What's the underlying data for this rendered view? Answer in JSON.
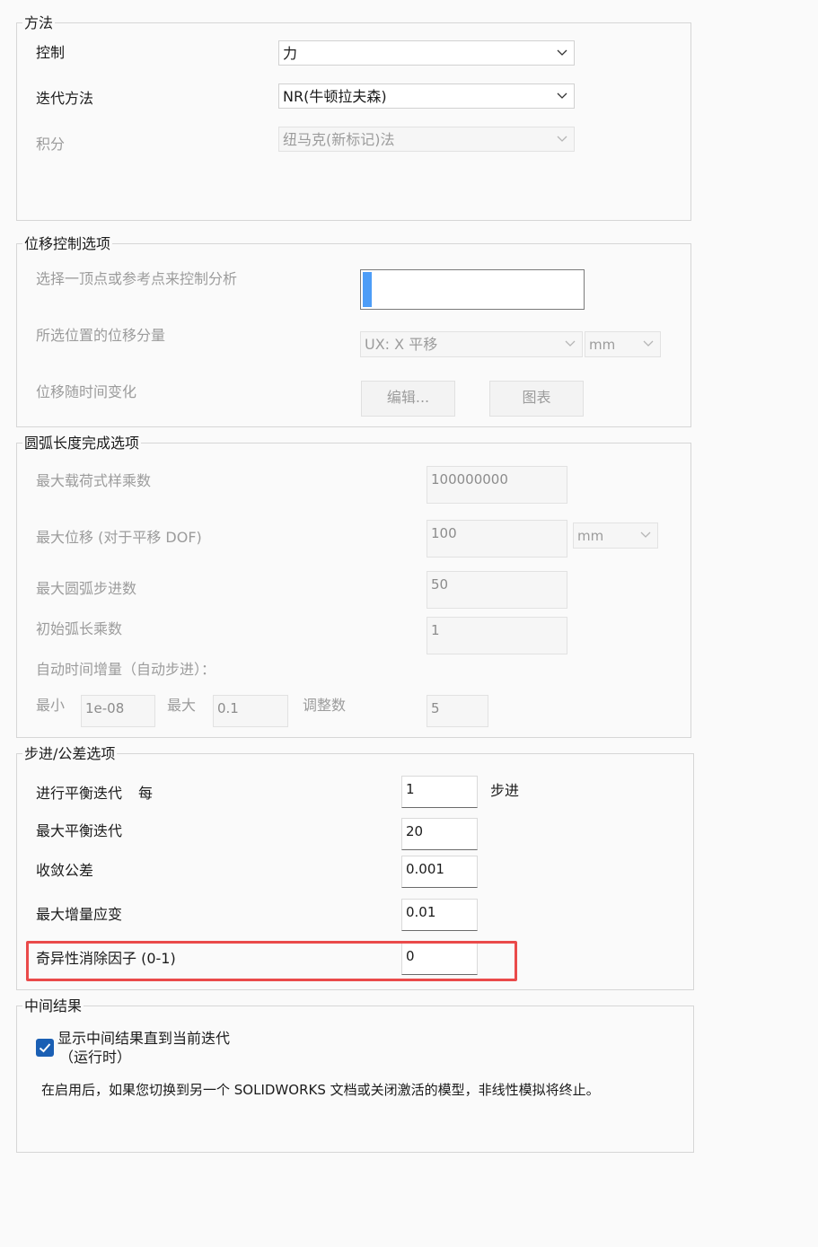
{
  "method": {
    "title": "方法",
    "control_label": "控制",
    "control_value": "力",
    "iteration_label": "迭代方法",
    "iteration_value": "NR(牛顿拉夫森)",
    "integration_label": "积分",
    "integration_value": "纽马克(新标记)法"
  },
  "displacement": {
    "title": "位移控制选项",
    "select_label": "选择一顶点或参考点来控制分析",
    "component_label": "所选位置的位移分量",
    "component_value": "UX: X 平移",
    "unit_value": "mm",
    "variation_label": "位移随时间变化",
    "edit_button": "编辑...",
    "chart_button": "图表"
  },
  "arc": {
    "title": "圆弧长度完成选项",
    "max_load_label": "最大载荷式样乘数",
    "max_load_value": "100000000",
    "max_disp_label": "最大位移 (对于平移 DOF)",
    "max_disp_value": "100",
    "max_disp_unit": "mm",
    "max_steps_label": "最大圆弧步进数",
    "max_steps_value": "50",
    "init_mult_label": "初始弧长乘数",
    "init_mult_value": "1",
    "auto_label": "自动时间增量（自动步进）：",
    "min_label": "最小",
    "min_value": "1e-08",
    "max_label": "最大",
    "max_value": "0.1",
    "adjust_label": "调整数",
    "adjust_value": "5"
  },
  "stepping": {
    "title": "步进/公差选项",
    "equil_label": "进行平衡迭代",
    "equil_every": "每",
    "equil_value": "1",
    "equil_unit": "步进",
    "max_equil_label": "最大平衡迭代",
    "max_equil_value": "20",
    "tolerance_label": "收敛公差",
    "tolerance_value": "0.001",
    "max_strain_label": "最大增量应变",
    "max_strain_value": "0.01",
    "singularity_label": "奇异性消除因子 (0-1)",
    "singularity_value": "0"
  },
  "intermediate": {
    "title": "中间结果",
    "checkbox_label_1": "显示中间结果直到当前迭代",
    "checkbox_label_2": "（运行时）",
    "checked": true,
    "note": "在启用后，如果您切换到另一个 SOLIDWORKS 文档或关闭激活的模型，非线性模拟将终止。"
  },
  "colors": {
    "accent": "#1a5fb4",
    "highlight": "#ea4a4a",
    "vertex_selection": "#4d9df7"
  }
}
